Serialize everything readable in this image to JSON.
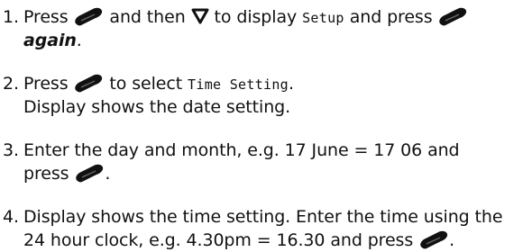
{
  "steps": [
    {
      "number": "1.",
      "line1": {
        "t1": "Press",
        "icon1": "ok-button-icon",
        "t2": "and then",
        "icon2": "down-arrow-button-icon",
        "t3": "to display",
        "lcd": "Setup",
        "t4": "and press",
        "icon3": "ok-button-icon"
      },
      "line2": {
        "emphasis": "again",
        "t1": "."
      }
    },
    {
      "number": "2.",
      "line1": {
        "t1": "Press",
        "icon1": "ok-button-icon",
        "t2": "to select",
        "lcd": "Time Setting",
        "t3": "."
      },
      "line2": {
        "t1": "Display shows the date setting."
      }
    },
    {
      "number": "3.",
      "line1": {
        "t1": "Enter the day and month, e.g. 17 June = 17 06 and"
      },
      "line2": {
        "t1": "press",
        "icon1": "ok-button-icon",
        "t2": "."
      }
    },
    {
      "number": "4.",
      "line1": {
        "t1": "Display shows the time setting. Enter the time using the"
      },
      "line2": {
        "t1": "24 hour clock, e.g. 4.30pm = 16.30 and press",
        "icon1": "ok-button-icon",
        "t2": "."
      }
    }
  ],
  "colors": {
    "text": "#111111",
    "icon": "#111111",
    "background": "#ffffff"
  }
}
